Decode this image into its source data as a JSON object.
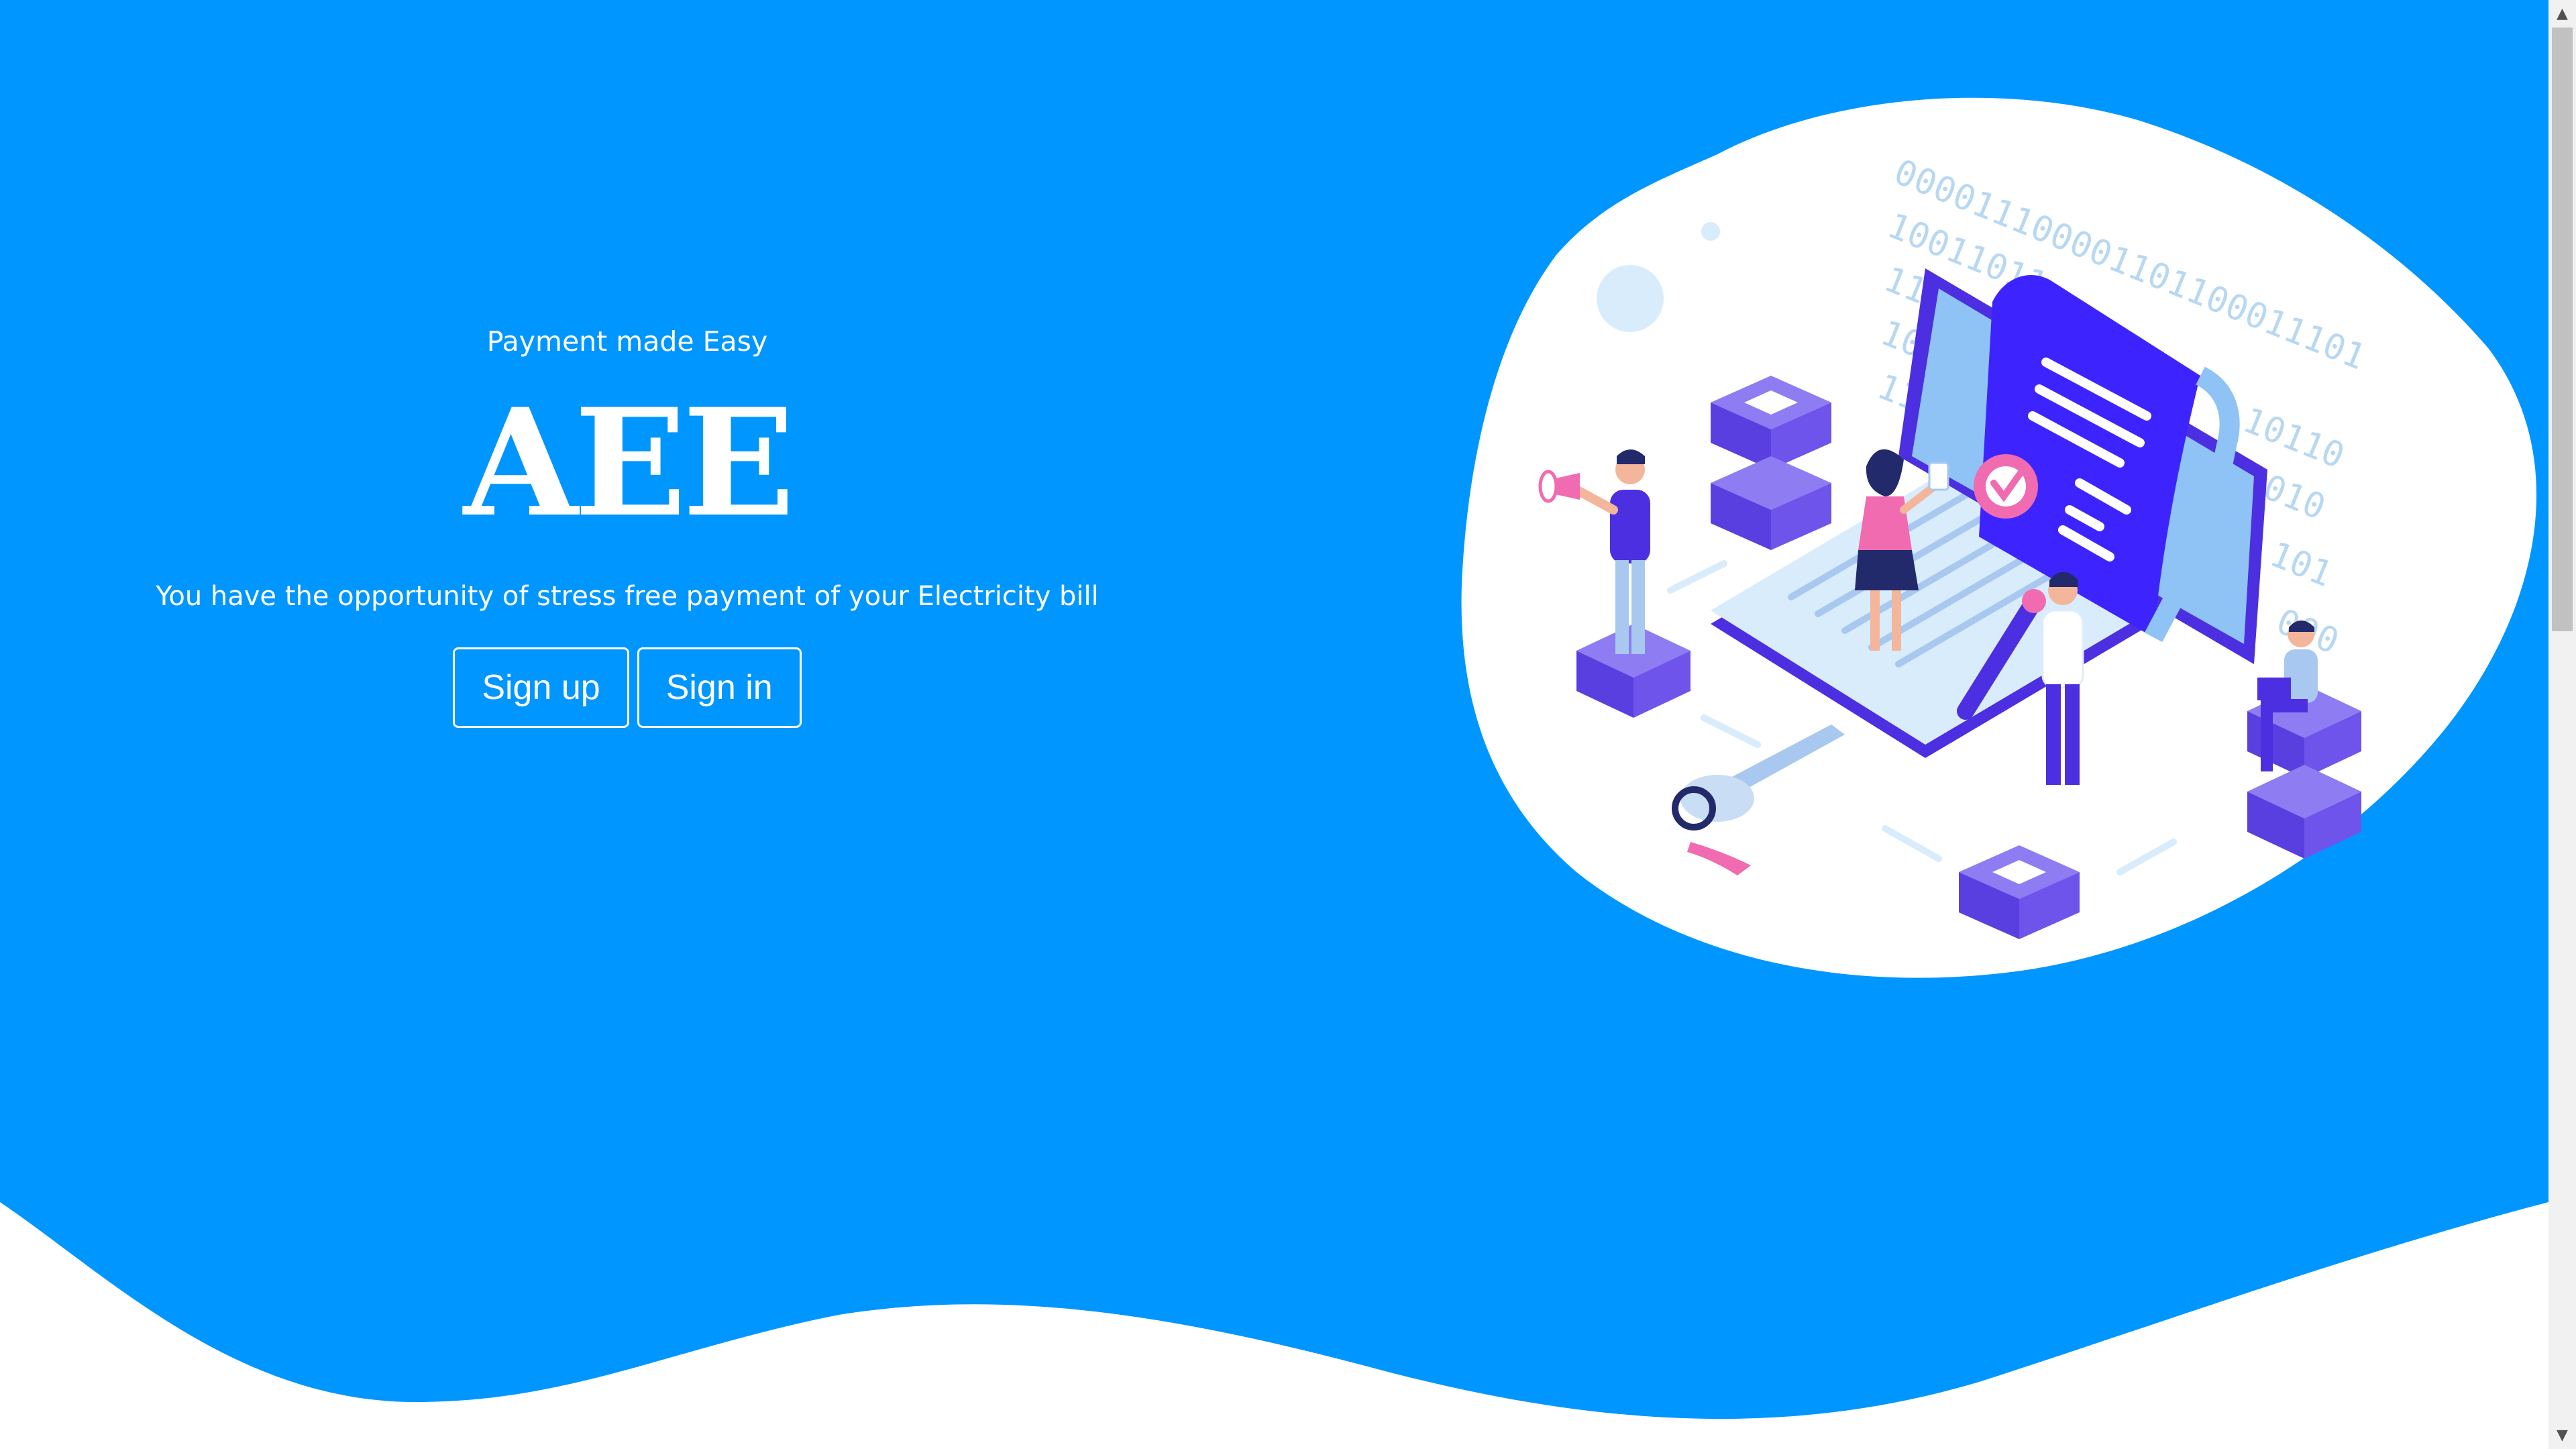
{
  "hero": {
    "tagline": "Payment made Easy",
    "logo_text": "AEE",
    "description": "You have the opportunity of stress free payment of your Electricity bill",
    "signup_label": "Sign up",
    "signin_label": "Sign in"
  },
  "illustration": {
    "binary_lines": [
      "000011100001101100011101",
      "10011011",
      "110110",
      "10",
      "11"
    ],
    "binary_right": [
      "10110",
      "010",
      "101",
      "000"
    ]
  },
  "colors": {
    "hero_blue": "#0096ff",
    "white": "#ffffff",
    "accent_purple": "#4b2fe0",
    "accent_pink": "#f06bb0",
    "light_blue": "#d8ecfb"
  },
  "scrollbar": {
    "up_icon": "▲",
    "down_icon": "▼"
  }
}
